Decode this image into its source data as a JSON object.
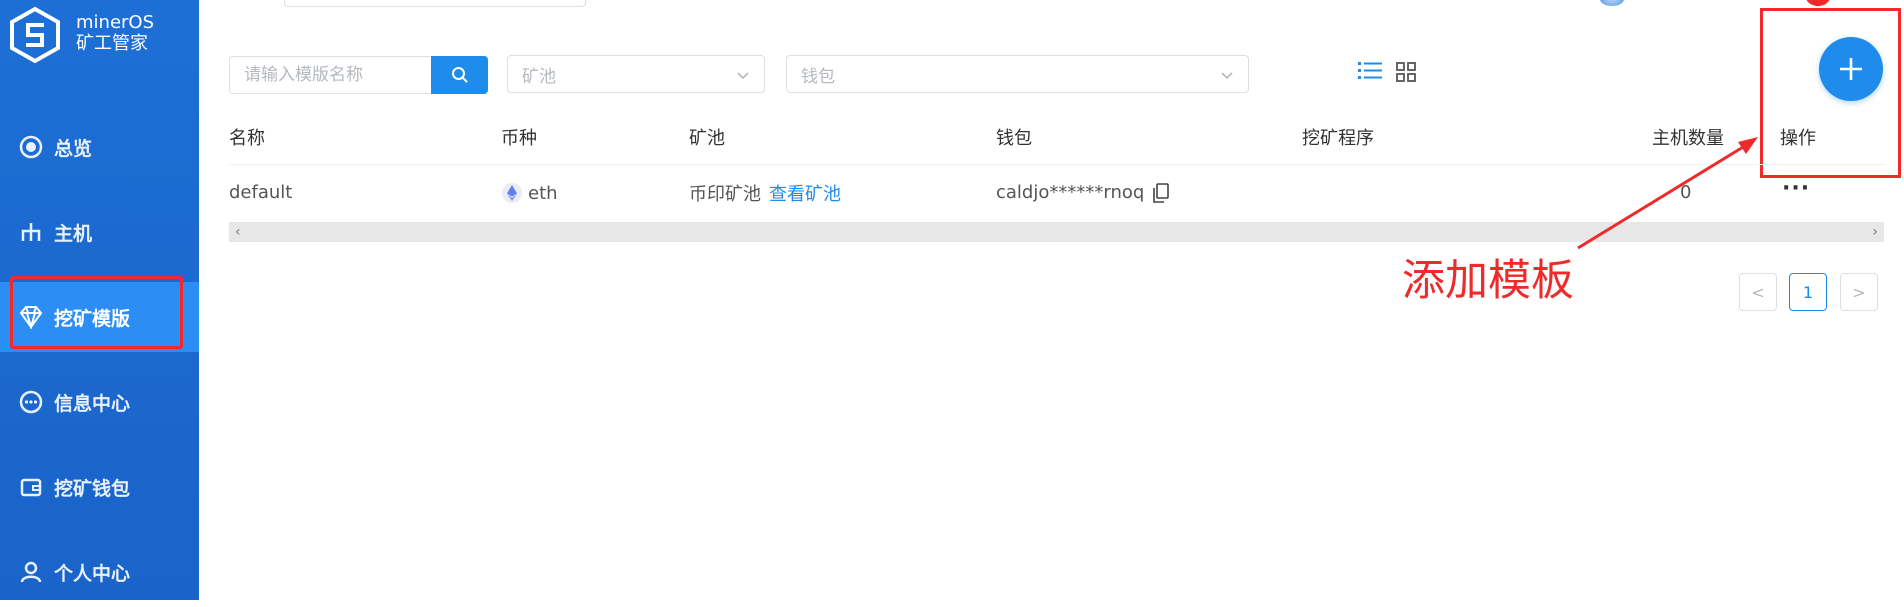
{
  "app": {
    "name": "minerOS",
    "subtitle": "矿工管家"
  },
  "sidebar": {
    "items": [
      {
        "label": "总览",
        "icon": "overview-icon"
      },
      {
        "label": "主机",
        "icon": "host-icon"
      },
      {
        "label": "挖矿模版",
        "icon": "diamond-icon",
        "active": true
      },
      {
        "label": "信息中心",
        "icon": "message-icon"
      },
      {
        "label": "挖矿钱包",
        "icon": "wallet-icon"
      },
      {
        "label": "个人中心",
        "icon": "user-icon"
      }
    ]
  },
  "filters": {
    "search_placeholder": "请输入模版名称",
    "pool_placeholder": "矿池",
    "wallet_placeholder": "钱包"
  },
  "table": {
    "headers": [
      "名称",
      "币种",
      "矿池",
      "钱包",
      "挖矿程序",
      "主机数量",
      "操作"
    ],
    "rows": [
      {
        "name": "default",
        "coin": "eth",
        "pool": "币印矿池",
        "pool_link": "查看矿池",
        "wallet": "caldjo******rnoq",
        "program": "",
        "hosts": "0",
        "actions": "···"
      }
    ]
  },
  "pagination": {
    "prev": "<",
    "current": "1",
    "next": ">"
  },
  "annotation": {
    "label": "添加模板",
    "color": "#f02a2a"
  },
  "colors": {
    "sidebar": "#1d6fd6",
    "accent": "#1f8ceb",
    "highlight": "#f02a2a"
  }
}
